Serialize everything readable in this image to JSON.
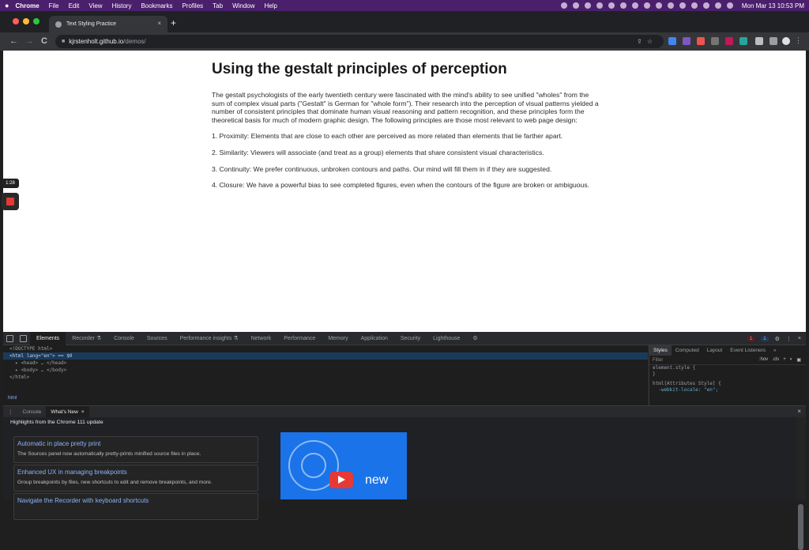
{
  "menubar": {
    "apple": "",
    "items": [
      "Chrome",
      "File",
      "Edit",
      "View",
      "History",
      "Bookmarks",
      "Profiles",
      "Tab",
      "Window",
      "Help"
    ],
    "clock": "Mon Mar 13  10:53 PM"
  },
  "browser": {
    "tab_title": "Text Styling Practice",
    "tab_close": "×",
    "new_tab": "+",
    "url_host": "kjrstenholt.github.io",
    "url_path": "/demos/",
    "back": "←",
    "forward": "→",
    "reload": "C"
  },
  "page": {
    "title": "Using the gestalt principles of perception",
    "intro": "The gestalt psychologists of the early twentieth century were fascinated with the mind's ability to see unified \"wholes\" from the sum of complex visual parts (\"Gestalt\" is German for \"whole form\"). Their research into the perception of visual patterns yielded a number of consistent principles that dominate human visual reasoning and pattern recognition, and these principles form the theoretical basis for much of modern graphic design. The following principles are those most relevant to web page design:",
    "principles": [
      "1. Proximity: Elements that are close to each other are perceived as more related than elements that lie farther apart.",
      "2. Similarity: Viewers will associate (and treat as a group) elements that share consistent visual characteristics.",
      "3. Continuity: We prefer continuous, unbroken contours and paths. Our mind will fill them in if they are suggested.",
      "4. Closure: We have a powerful bias to see completed figures, even when the contours of the figure are broken or ambiguous."
    ],
    "recording_time": "1:28"
  },
  "devtools": {
    "tabs": [
      "Elements",
      "Recorder ⚗",
      "Console",
      "Sources",
      "Performance insights ⚗",
      "Network",
      "Performance",
      "Memory",
      "Application",
      "Security",
      "Lighthouse"
    ],
    "error_count": "1",
    "info_count": "1",
    "dom_lines": [
      "<!DOCTYPE html>",
      "<html lang=\"en\"> == $0",
      "  ▸ <head> … </head>",
      "  ▸ <body> … </body>",
      "</html>"
    ],
    "breadcrumb": "html",
    "styles_tabs": [
      "Styles",
      "Computed",
      "Layout",
      "Event Listeners",
      "»"
    ],
    "filter_placeholder": "Filter",
    "filter_hov": ":hov",
    "filter_cls": ".cls",
    "filter_plus": "+",
    "style_lines": [
      "element.style {",
      "}",
      "html[Attributes Style] {",
      "  -webkit-locale: \"en\";"
    ],
    "drawer_tabs": [
      "Console",
      "What's New"
    ],
    "drawer_close": "×",
    "whats_new_heading": "Highlights from the Chrome 111 update",
    "cards": [
      {
        "title": "Automatic in place pretty print",
        "desc": "The Sources panel now automatically pretty-prints minified source files in place."
      },
      {
        "title": "Enhanced UX in managing breakpoints",
        "desc": "Group breakpoints by files, new shortcuts to edit and remove breakpoints, and more."
      },
      {
        "title": "Navigate the Recorder with keyboard shortcuts",
        "desc": ""
      }
    ],
    "video_text": "new"
  },
  "colors": {
    "menubar": "#4a1f6b",
    "link": "#8ab4f8",
    "video_bg": "#1a73e8"
  }
}
